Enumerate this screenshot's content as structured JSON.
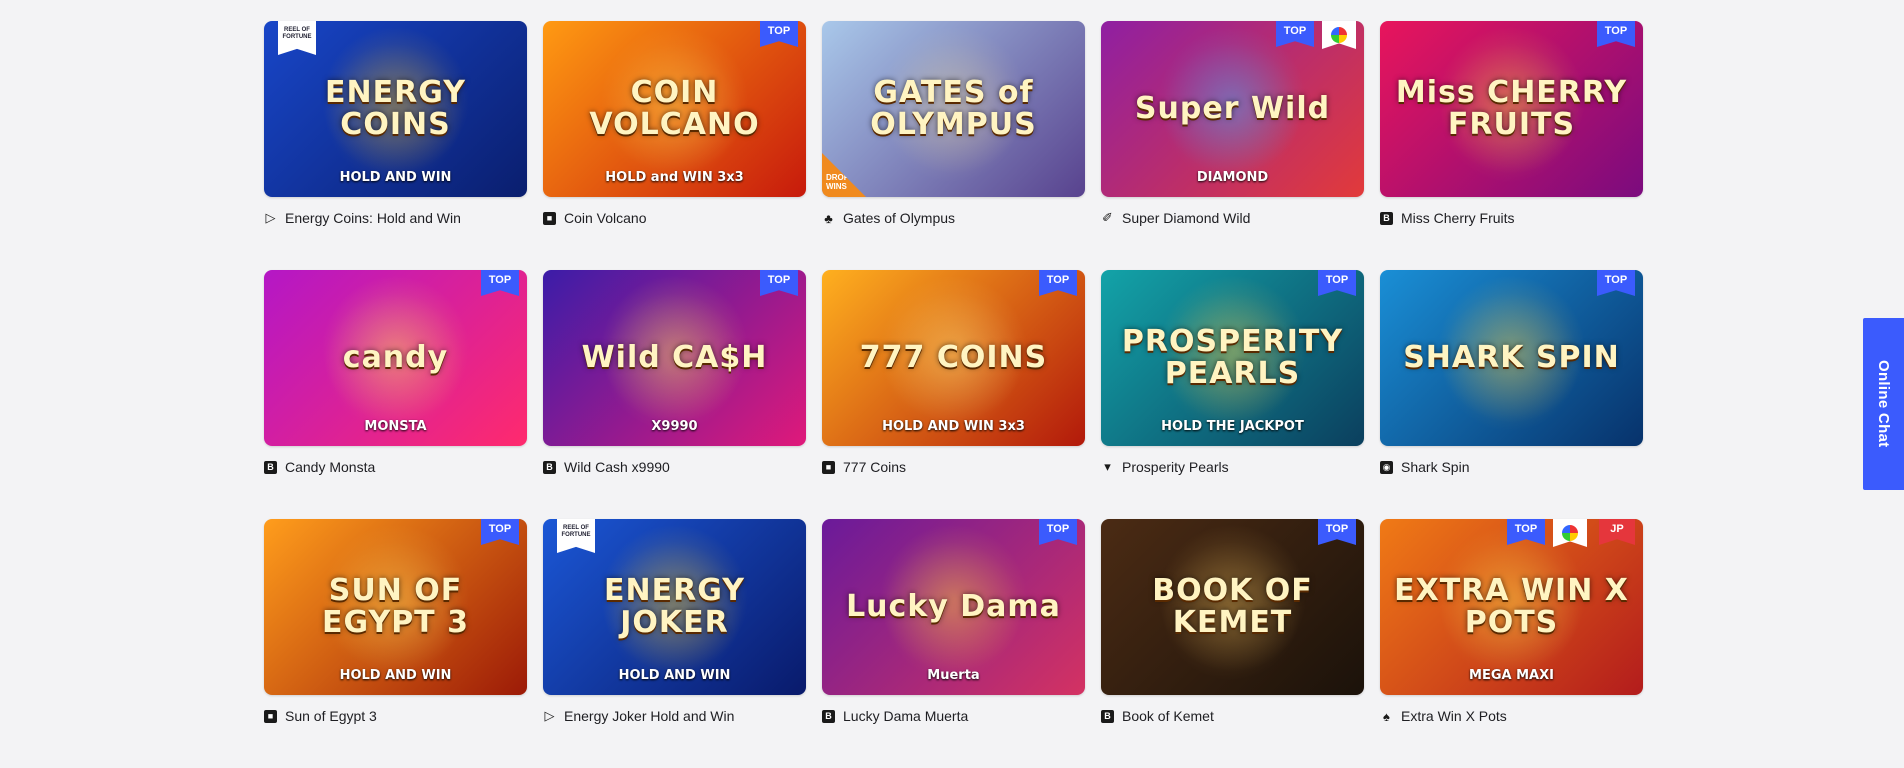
{
  "games": [
    {
      "name": "Energy Coins: Hold and Win",
      "art_text": "ENERGY COINS",
      "art_sub": "HOLD AND WIN",
      "provider_icon": "play-flag-icon",
      "badges": [
        "reel-of-fortune"
      ],
      "bg": [
        "#1846c8",
        "#0a1e6e"
      ],
      "accent": "#f5c22a"
    },
    {
      "name": "Coin Volcano",
      "art_text": "COIN VOLCANO",
      "art_sub": "HOLD and WIN 3x3",
      "provider_icon": "shield-card-icon",
      "badges": [
        "TOP"
      ],
      "bg": [
        "#ff9a12",
        "#c71a0c"
      ],
      "accent": "#ffdd55"
    },
    {
      "name": "Gates of Olympus",
      "art_text": "GATES of OLYMPUS",
      "art_sub": "",
      "provider_icon": "flame-icon",
      "badges": [
        "DROPS & WINS"
      ],
      "bg": [
        "#a9c8ea",
        "#58428e"
      ],
      "accent": "#e7d7a0"
    },
    {
      "name": "Super Diamond Wild",
      "art_text": "Super Wild",
      "art_sub": "DIAMOND",
      "provider_icon": "is-provider-icon",
      "badges": [
        "TOP",
        "drops-wheel"
      ],
      "bg": [
        "#8f1fa2",
        "#e23a3a"
      ],
      "accent": "#3fb1ff"
    },
    {
      "name": "Miss Cherry Fruits",
      "art_text": "Miss CHERRY FRUITS",
      "art_sub": "",
      "provider_icon": "b-provider-icon",
      "badges": [
        "TOP"
      ],
      "bg": [
        "#e8155c",
        "#7b0b7e"
      ],
      "accent": "#ffd23b"
    },
    {
      "name": "Candy Monsta",
      "art_text": "candy",
      "art_sub": "MONSTA",
      "provider_icon": "b-provider-icon",
      "badges": [
        "TOP"
      ],
      "bg": [
        "#b417c6",
        "#ff2a6d"
      ],
      "accent": "#ffe45c"
    },
    {
      "name": "Wild Cash x9990",
      "art_text": "Wild CA$H",
      "art_sub": "X9990",
      "provider_icon": "b-provider-icon",
      "badges": [
        "TOP"
      ],
      "bg": [
        "#3b1ca8",
        "#e0197a"
      ],
      "accent": "#ffe35b"
    },
    {
      "name": "777 Coins",
      "art_text": "777 COINS",
      "art_sub": "HOLD AND WIN 3x3",
      "provider_icon": "shield-card-icon",
      "badges": [
        "TOP"
      ],
      "bg": [
        "#ffb01f",
        "#b2190b"
      ],
      "accent": "#ffe27a"
    },
    {
      "name": "Prosperity Pearls",
      "art_text": "PROSPERITY PEARLS",
      "art_sub": "HOLD THE JACKPOT",
      "provider_icon": "chevron-down-icon",
      "badges": [
        "TOP"
      ],
      "bg": [
        "#13a3a8",
        "#0b3f5e"
      ],
      "accent": "#f3d14a"
    },
    {
      "name": "Shark Spin",
      "art_text": "SHARK SPIN",
      "art_sub": "",
      "provider_icon": "shield-icon",
      "badges": [
        "TOP"
      ],
      "bg": [
        "#1a8fd6",
        "#07326b"
      ],
      "accent": "#ffd746"
    },
    {
      "name": "Sun of Egypt 3",
      "art_text": "SUN OF EGYPT 3",
      "art_sub": "HOLD AND WIN",
      "provider_icon": "shield-card-icon",
      "badges": [
        "TOP"
      ],
      "bg": [
        "#ff9d1c",
        "#9c1a07"
      ],
      "accent": "#ffd85a"
    },
    {
      "name": "Energy Joker Hold and Win",
      "art_text": "ENERGY JOKER",
      "art_sub": "HOLD AND WIN",
      "provider_icon": "play-flag-icon",
      "badges": [
        "reel-of-fortune"
      ],
      "bg": [
        "#1b57d6",
        "#091a6b"
      ],
      "accent": "#ffd12e"
    },
    {
      "name": "Lucky Dama Muerta",
      "art_text": "Lucky Dama",
      "art_sub": "Muerta",
      "provider_icon": "b-provider-icon",
      "badges": [
        "TOP"
      ],
      "bg": [
        "#6a1a9a",
        "#d43262"
      ],
      "accent": "#ffcf3a"
    },
    {
      "name": "Book of Kemet",
      "art_text": "BOOK OF KEMET",
      "art_sub": "",
      "provider_icon": "b-provider-icon",
      "badges": [
        "TOP"
      ],
      "bg": [
        "#4b2b14",
        "#1b120a"
      ],
      "accent": "#e7b85a"
    },
    {
      "name": "Extra Win X Pots",
      "art_text": "EXTRA WIN X POTS",
      "art_sub": "MEGA MAXI",
      "provider_icon": "spade-icon",
      "badges": [
        "TOP",
        "drops-wheel",
        "JP"
      ],
      "bg": [
        "#f07a16",
        "#b31c1c"
      ],
      "accent": "#ffe04d"
    }
  ],
  "badge_labels": {
    "top": "TOP",
    "jp": "JP",
    "reel_of_fortune": "REEL OF FORTUNE",
    "drops_wins": "DROPS & WINS"
  },
  "chat": {
    "label": "Online Chat",
    "color": "#3b5bfd"
  }
}
